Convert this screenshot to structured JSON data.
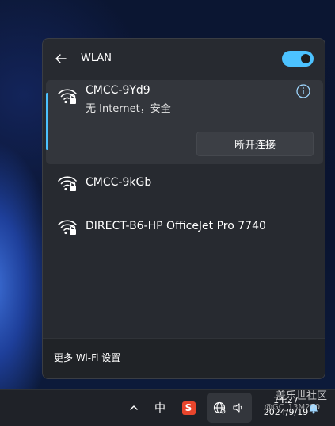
{
  "panel": {
    "title": "WLAN",
    "wifi_enabled": true,
    "accent_color": "#4cc2ff"
  },
  "connected": {
    "ssid": "CMCC-9Yd9",
    "status": "无 Internet，安全",
    "disconnect_label": "断开连接",
    "icon": "wifi-secured-icon"
  },
  "networks": [
    {
      "ssid": "CMCC-9kGb",
      "icon": "wifi-secured-icon"
    },
    {
      "ssid": "DIRECT-B6-HP OfficeJet Pro 7740",
      "icon": "wifi-secured-icon"
    }
  ],
  "footer": {
    "more_settings": "更多 Wi-Fi 设置"
  },
  "taskbar": {
    "chevron": "^",
    "ime": "中",
    "ime_app": "S",
    "time": "14:27",
    "date": "2024/9/19",
    "watermark": "盖乐世社区",
    "watermark_sub": "@GC_13M220"
  }
}
